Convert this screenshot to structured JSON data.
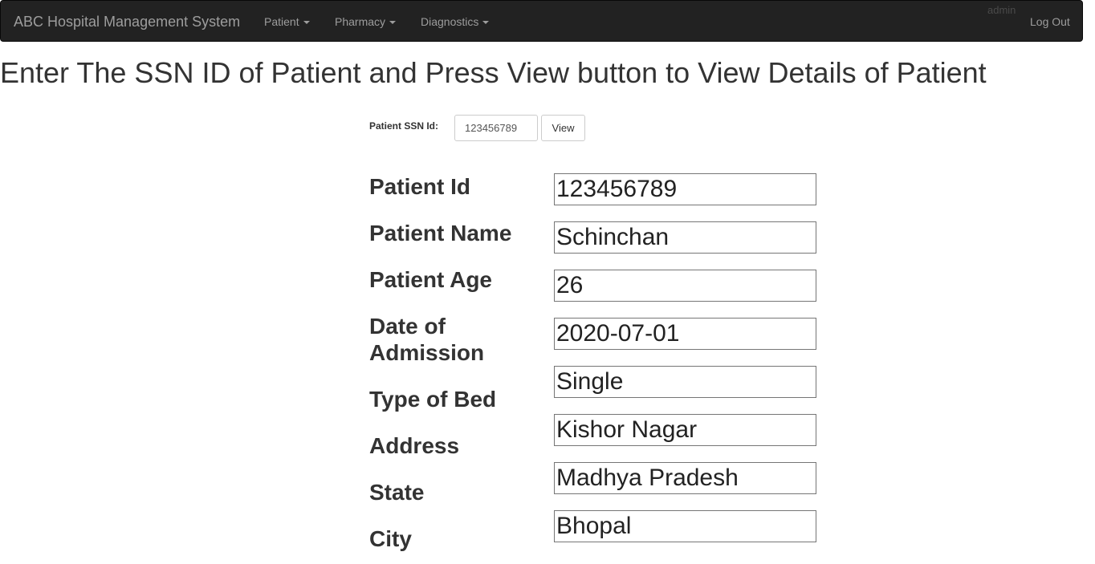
{
  "navbar": {
    "brand": "ABC Hospital Management System",
    "menus": [
      {
        "label": "Patient"
      },
      {
        "label": "Pharmacy"
      },
      {
        "label": "Diagnostics"
      }
    ],
    "user": "admin",
    "logout_label": "Log Out"
  },
  "page": {
    "title": "Enter The SSN ID of Patient and Press View button to View Details of Patient"
  },
  "search": {
    "label": "Patient SSN Id:",
    "value": "123456789",
    "button_label": "View"
  },
  "fields": [
    {
      "label": "Patient Id",
      "value": "123456789"
    },
    {
      "label": "Patient Name",
      "value": "Schinchan"
    },
    {
      "label": "Patient Age",
      "value": "26"
    },
    {
      "label": "Date of Admission",
      "value": "2020-07-01"
    },
    {
      "label": "Type of Bed",
      "value": "Single"
    },
    {
      "label": "Address",
      "value": "Kishor Nagar"
    },
    {
      "label": "State",
      "value": "Madhya Pradesh"
    },
    {
      "label": "City",
      "value": "Bhopal"
    }
  ]
}
